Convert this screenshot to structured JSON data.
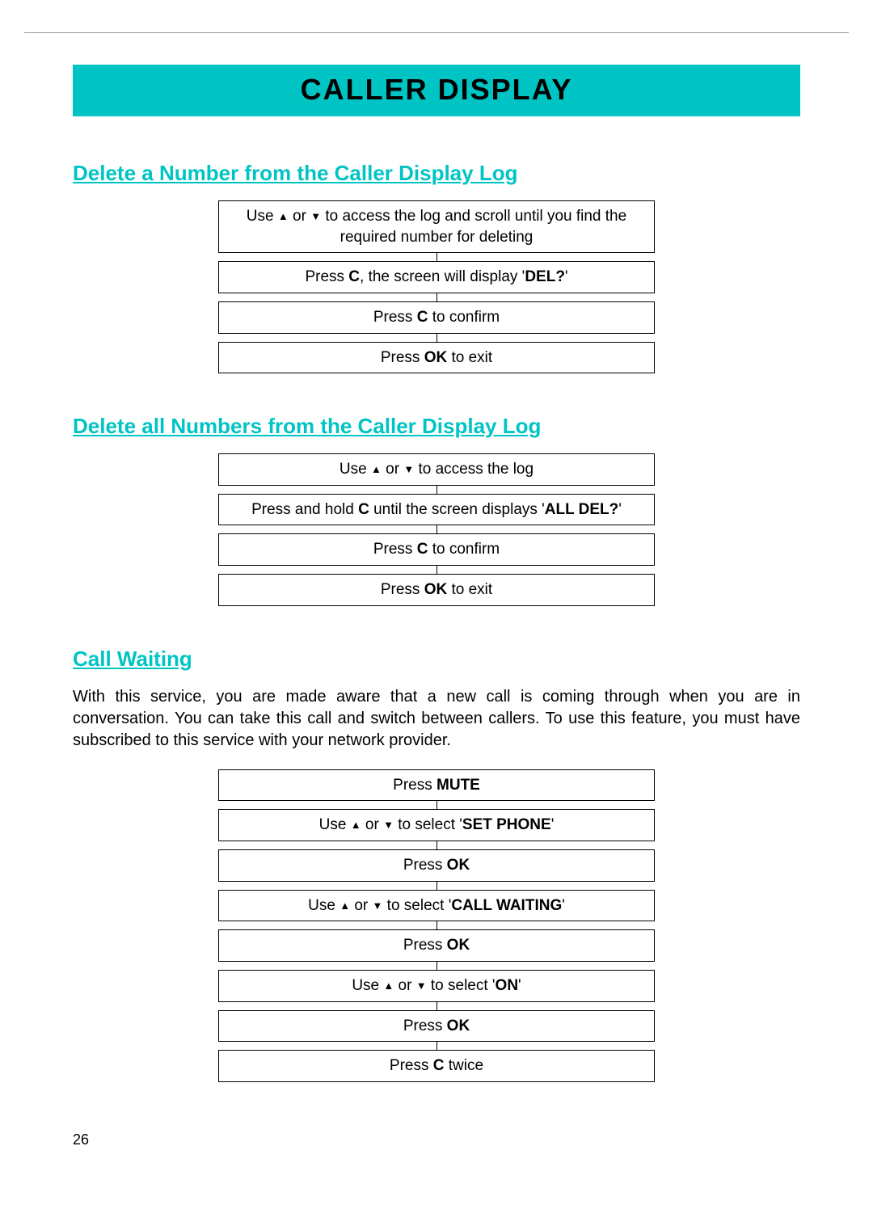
{
  "banner": "CALLER DISPLAY",
  "section1": {
    "title": "Delete a Number from the Caller Display Log",
    "steps": [
      {
        "pre": "Use ",
        "arrows": true,
        "mid": " to access the log and scroll until you find the required number for deleting"
      },
      {
        "pre": "Press ",
        "bold1": "C",
        "mid": ", the screen will display '",
        "bold2": "DEL?",
        "post": "'"
      },
      {
        "pre": "Press ",
        "bold1": "C",
        "mid": " to confirm"
      },
      {
        "pre": "Press ",
        "bold1": "OK",
        "mid": " to exit"
      }
    ]
  },
  "section2": {
    "title": "Delete all Numbers from the Caller Display Log",
    "steps": [
      {
        "pre": "Use ",
        "arrows": true,
        "mid": " to access the log"
      },
      {
        "pre": "Press and hold ",
        "bold1": "C",
        "mid": " until  the screen displays '",
        "bold2": "ALL DEL?",
        "post": "'"
      },
      {
        "pre": "Press ",
        "bold1": "C",
        "mid": " to confirm"
      },
      {
        "pre": "Press ",
        "bold1": "OK",
        "mid": " to exit"
      }
    ]
  },
  "section3": {
    "title": "Call Waiting",
    "body": "With this service, you are made aware that a new call is coming through when you are in conversation. You can take this call and switch between callers. To use this feature, you must have subscribed to this service with your network provider.",
    "steps": [
      {
        "pre": "Press ",
        "bold1": "MUTE"
      },
      {
        "pre": "Use ",
        "arrows": true,
        "mid": " to select '",
        "bold2": "SET PHONE",
        "post": "'"
      },
      {
        "pre": "Press ",
        "bold1": "OK"
      },
      {
        "pre": "Use ",
        "arrows": true,
        "mid": " to select '",
        "bold2": "CALL WAITING",
        "post": "'"
      },
      {
        "pre": "Press ",
        "bold1": "OK"
      },
      {
        "pre": "Use ",
        "arrows": true,
        "mid": " to select '",
        "bold2": "ON",
        "post": "'"
      },
      {
        "pre": "Press ",
        "bold1": "OK"
      },
      {
        "pre": "Press ",
        "bold1": "C",
        "mid": " twice"
      }
    ]
  },
  "pageNumber": "26"
}
